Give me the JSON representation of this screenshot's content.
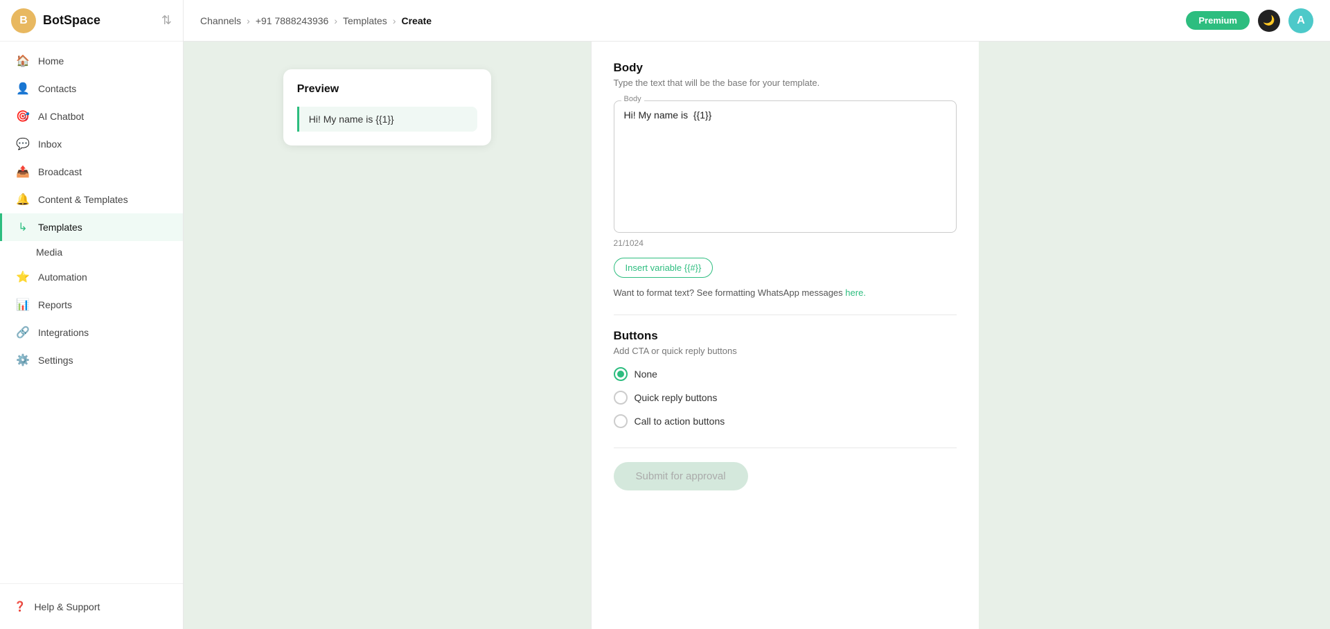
{
  "sidebar": {
    "brand": "BotSpace",
    "avatar_initial": "B",
    "items": [
      {
        "id": "home",
        "label": "Home",
        "icon": "🏠"
      },
      {
        "id": "contacts",
        "label": "Contacts",
        "icon": "👤"
      },
      {
        "id": "ai-chatbot",
        "label": "AI Chatbot",
        "icon": "🎯"
      },
      {
        "id": "inbox",
        "label": "Inbox",
        "icon": "💬"
      },
      {
        "id": "broadcast",
        "label": "Broadcast",
        "icon": "📤"
      },
      {
        "id": "content-templates",
        "label": "Content & Templates",
        "icon": "🔔"
      },
      {
        "id": "templates",
        "label": "Templates",
        "icon": "↳",
        "active": true,
        "sub": true
      },
      {
        "id": "media",
        "label": "Media",
        "sub": true
      },
      {
        "id": "automation",
        "label": "Automation",
        "icon": "⭐"
      },
      {
        "id": "reports",
        "label": "Reports",
        "icon": "📊"
      },
      {
        "id": "integrations",
        "label": "Integrations",
        "icon": "🔗"
      },
      {
        "id": "settings",
        "label": "Settings",
        "icon": "⚙️"
      }
    ],
    "footer": [
      {
        "id": "help",
        "label": "Help & Support",
        "icon": "❓"
      }
    ]
  },
  "topbar": {
    "breadcrumbs": [
      {
        "label": "Channels"
      },
      {
        "label": "+91 7888243936"
      },
      {
        "label": "Templates"
      },
      {
        "label": "Create"
      }
    ],
    "premium_label": "Premium",
    "user_initial": "A"
  },
  "preview": {
    "title": "Preview",
    "message": "Hi! My name is  {{1}}"
  },
  "form": {
    "body_section_title": "Body",
    "body_section_desc": "Type the text that will be the base for your template.",
    "body_label": "Body",
    "body_value": "Hi! My name is  {{1}}",
    "char_count": "21/1024",
    "insert_variable_label": "Insert variable {{#}}",
    "format_text": "Want to format text? See formatting WhatsApp messages",
    "format_link": "here.",
    "buttons_title": "Buttons",
    "buttons_desc": "Add CTA or quick reply buttons",
    "radio_none": "None",
    "radio_quick_reply": "Quick reply buttons",
    "radio_cta": "Call to action buttons",
    "submit_label": "Submit for approval"
  }
}
